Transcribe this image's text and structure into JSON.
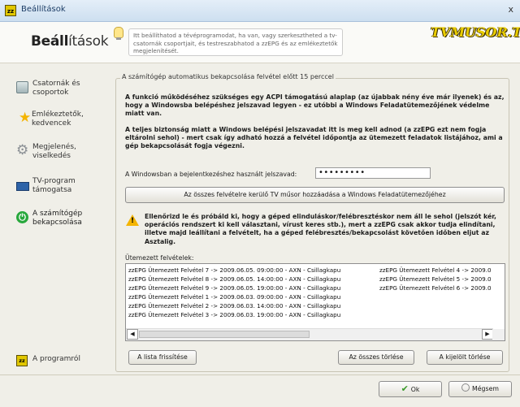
{
  "window": {
    "title": "Beállítások",
    "close": "x"
  },
  "banner": {
    "title_a": "Beáll",
    "title_b": "ítások",
    "hint": "Itt beállíthatod a tévéprogramodat, ha van, vagy szerkesztheted a tv-csatornák csoportjait, és testreszabhatod a zzEPG és az emlékeztetők megjelenítését.",
    "logo": "TVMUSOR.TV"
  },
  "sidebar": {
    "items": [
      {
        "label": "Csatornák és csoportok",
        "icon": "network-icon"
      },
      {
        "label": "Emlékeztetők, kedvencek",
        "icon": "star-icon"
      },
      {
        "label": "Megjelenés, viselkedés",
        "icon": "gear-icon"
      },
      {
        "label": "TV-program támogatsa",
        "icon": "tv-icon"
      },
      {
        "label": "A számítógép bekapcsolása",
        "icon": "power-icon"
      }
    ],
    "about": "A programról"
  },
  "section": {
    "legend": "A számítógép automatikus bekapcsolása felvétel előtt 15 perccel",
    "p1": "A funkció működéséhez szükséges egy ACPI támogatású alaplap (az újabbak nény éve már ilyenek) és az, hogy a Windowsba belépéshez jelszavad legyen - ez utóbbi a Windows Feladatütemezőjének védelme miatt van.",
    "p2": "A teljes biztonság miatt a Windows belépési jelszavadat itt is meg kell adnod (a zzEPG ezt nem fogja eltárolni sehol) - mert csak így adható hozzá a felvétel időpontja az ütemezett feladatok listájához, ami a gép bekapcsolását fogja végezni.",
    "password_label": "A Windowsban a bejelentkezéshez használt jelszavad:",
    "password_value": "•••••••••",
    "add_all_button": "Az összes felvételre kerülő TV műsor hozzáadása a Windows Feladatütemezőjéhez",
    "warning": "Ellenőrizd le és próbáld ki, hogy a géped elinduláskor/felébresztéskor nem áll le sehol (jelszót kér, operációs rendszert ki kell választani, vírust keres stb.), mert a zzEPG csak akkor tudja elindítani, illetve majd leállítani a felvételt, ha a géped felébresztés/bekapcsolást követően időben eljut az Asztalig.",
    "scheduled_label": "Ütemezett felvételek:",
    "list_col1": [
      "zzEPG Ütemezett Felvétel 7 -> 2009.06.05. 09:00:00 - AXN - Csillagkapu",
      "zzEPG Ütemezett Felvétel 8 -> 2009.06.05. 14:00:00 - AXN - Csillagkapu",
      "zzEPG Ütemezett Felvétel 9 -> 2009.06.05. 19:00:00 - AXN - Csillagkapu",
      "zzEPG Ütemezett Felvétel 1 -> 2009.06.03. 09:00:00 - AXN - Csillagkapu",
      "zzEPG Ütemezett Felvétel 2 -> 2009.06.03. 14:00:00 - AXN - Csillagkapu",
      "zzEPG Ütemezett Felvétel 3 -> 2009.06.03. 19:00:00 - AXN - Csillagkapu"
    ],
    "list_col2": [
      "zzEPG Ütemezett Felvétel 4 -> 2009.0",
      "zzEPG Ütemezett Felvétel 5 -> 2009.0",
      "zzEPG Ütemezett Felvétel 6 -> 2009.0"
    ],
    "refresh_button": "A lista frissítése",
    "delete_all_button": "Az összes törlése",
    "delete_selected_button": "A kijelölt törlése"
  },
  "footer": {
    "ok": "Ok",
    "cancel": "Mégsem"
  },
  "colors": {
    "accent": "#e1c700",
    "title_blue": "#1c3d66",
    "power_green": "#28a83c"
  }
}
